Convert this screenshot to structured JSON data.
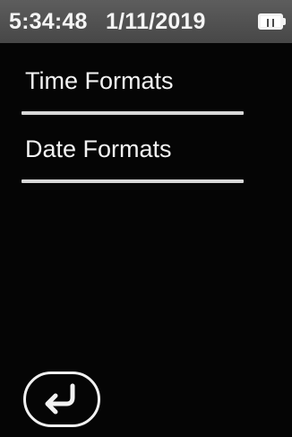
{
  "status_bar": {
    "time": "5:34:48",
    "date": "1/11/2019",
    "battery_icon": "battery-icon"
  },
  "menu": {
    "items": [
      {
        "label": "Time Formats"
      },
      {
        "label": "Date Formats"
      }
    ]
  },
  "back_button": {
    "icon": "return-arrow-icon"
  },
  "colors": {
    "background": "#050505",
    "status_bar": "#4f4f4f",
    "text": "#f3f3f3",
    "divider": "#d8d8d8"
  }
}
